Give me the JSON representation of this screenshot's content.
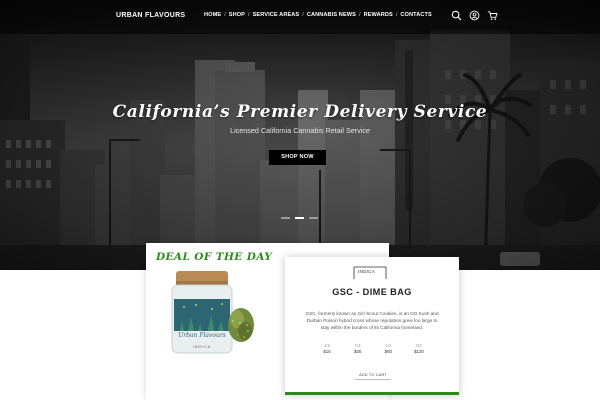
{
  "nav": {
    "logo": "URBAN FLAVOURS",
    "items": [
      "HOME",
      "SHOP",
      "SERVICE AREAS",
      "CANNABIS NEWS",
      "REWARDS",
      "CONTACTS"
    ],
    "separator": "/",
    "icons": [
      "search-icon",
      "user-icon",
      "cart-icon"
    ]
  },
  "hero": {
    "title": "California’s Premier Delivery Service",
    "subtitle": "Licensed California Cannabis Retail Service",
    "button": "SHOP NOW",
    "slides": 3,
    "active_slide": 1
  },
  "deal": {
    "title": "DEAL OF THE DAY",
    "jar_label": "Urban Flavours",
    "jar_sub": "INDICA"
  },
  "product": {
    "type_tag": "INDICA",
    "name": "GSC - DIME BAG",
    "description": "GSC, formerly known as Girl Scout Cookies, is an OG Kush and Durban Poison hybrid cross whose reputation grew too large to stay within the borders of its California homeland.",
    "prices": [
      {
        "weight": "1/8",
        "price": "$15"
      },
      {
        "weight": "1/4",
        "price": "$30"
      },
      {
        "weight": "1/2",
        "price": "$60"
      },
      {
        "weight": "OZ",
        "price": "$120"
      }
    ],
    "add_to_cart": "ADD TO CART"
  },
  "colors": {
    "accent_green": "#2e8a1f",
    "nav_bg": "#000000",
    "button_bg": "#000000"
  }
}
